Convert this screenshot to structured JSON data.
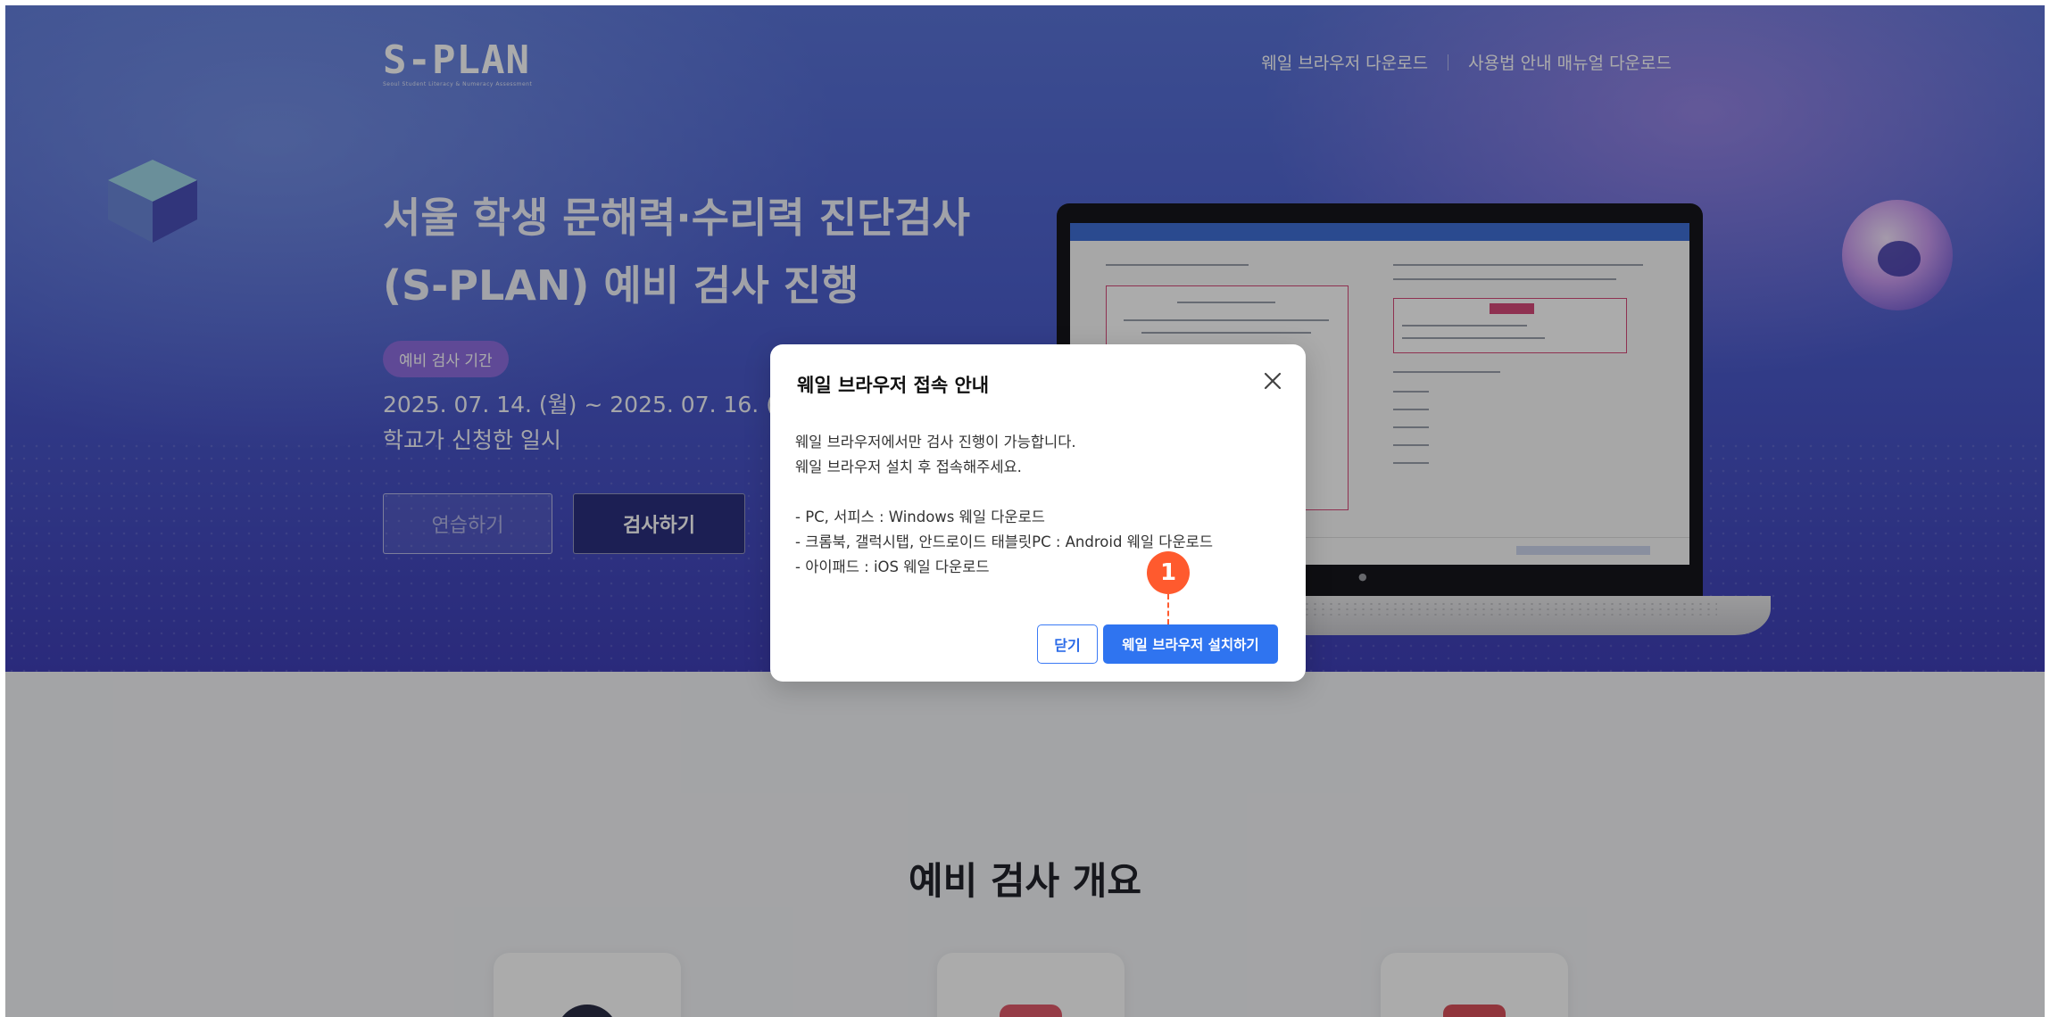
{
  "brand": {
    "logo": "S-PLAN",
    "logo_sub": "Seoul Student Literacy & Numeracy Assessment"
  },
  "topnav": {
    "whale_download": "웨일 브라우저 다운로드",
    "manual_download": "사용법 안내 매뉴얼 다운로드"
  },
  "hero": {
    "title_line1": "서울 학생 문해력·수리력 진단검사",
    "title_line2": "(S-PLAN) 예비 검사 진행",
    "period_label": "예비 검사 기간",
    "date_range": "2025. 07. 14. (월) ~ 2025. 07. 16. (수)",
    "date_note": "학교가 신청한 일시",
    "practice_button": "연습하기",
    "exam_button": "검사하기"
  },
  "overview": {
    "title": "예비 검사 개요"
  },
  "modal": {
    "title": "웨일 브라우저 접속 안내",
    "line1": "웨일 브라우저에서만 검사 진행이 가능합니다.",
    "line2": "웨일 브라우저 설치 후 접속해주세요.",
    "item1": "- PC, 서피스 : Windows 웨일 다운로드",
    "item2": "- 크롬북, 갤럭시탭, 안드로이드 태블릿PC : Android 웨일 다운로드",
    "item3": "- 아이패드 : iOS 웨일 다운로드",
    "close_button": "닫기",
    "install_button": "웨일 브라우저 설치하기"
  },
  "annotation": {
    "step_number": "1"
  },
  "colors": {
    "accent_blue": "#2f74f0",
    "marker_orange": "#ff5a2e",
    "chip_purple": "#8e6ee0"
  }
}
